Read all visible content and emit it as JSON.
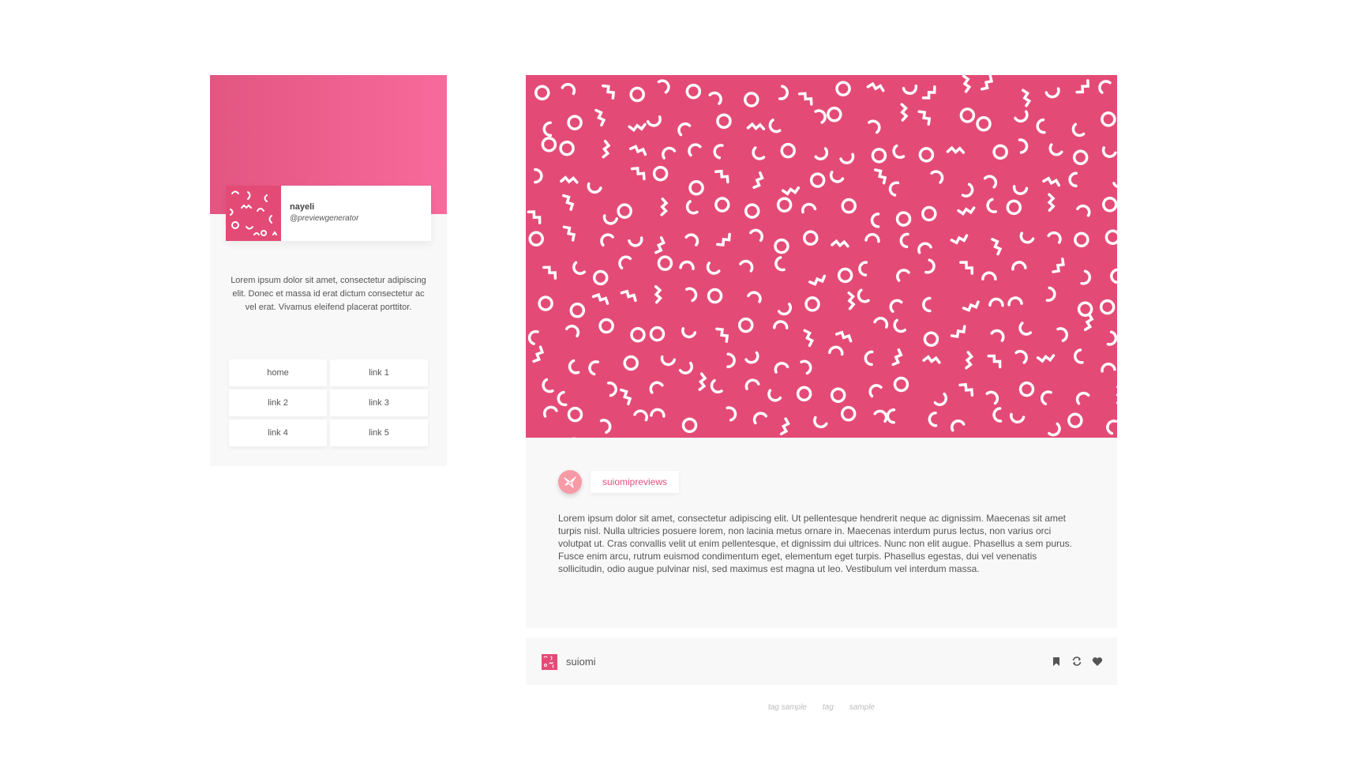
{
  "colors": {
    "accent": "#e34b76",
    "header_gradient_start": "#e25682",
    "header_gradient_end": "#f76a9b",
    "op_avatar": "#f79aa6",
    "panel": "#f8f8f8"
  },
  "sidebar": {
    "profile": {
      "name": "nayeli",
      "handle": "@previewgenerator",
      "avatar_icon": "pattern-avatar"
    },
    "bio": "Lorem ipsum dolor sit amet, consectetur adipiscing elit. Donec et massa id erat dictum consectetur ac vel erat. Vivamus eleifend placerat porttitor.",
    "nav": [
      {
        "label": "home"
      },
      {
        "label": "link 1"
      },
      {
        "label": "link 2"
      },
      {
        "label": "link 3"
      },
      {
        "label": "link 4"
      },
      {
        "label": "link 5"
      }
    ]
  },
  "post": {
    "image_icon": "memphis-squiggle-pattern",
    "op": {
      "name": "suiomipreviews",
      "avatar_icon": "hummingbird-icon"
    },
    "text": "Lorem ipsum dolor sit amet, consectetur adipiscing elit. Ut pellentesque hendrerit neque ac dignissim. Maecenas sit amet turpis nisl. Nulla ultricies posuere lorem, non lacinia metus ornare in. Maecenas interdum purus lectus, non varius orci volutpat ut. Cras convallis velit ut enim pellentesque, et dignissim dui ultrices. Nunc non elit augue. Phasellus a sem purus. Fusce enim arcu, rutrum euismod condimentum eget, elementum eget turpis. Phasellus egestas, dui vel venenatis sollicitudin, odio augue pulvinar nisl, sed maximus est magna ut leo. Vestibulum vel interdum massa.",
    "footer": {
      "username": "suiomi",
      "actions": [
        {
          "icon": "bookmark-icon"
        },
        {
          "icon": "reblog-icon"
        },
        {
          "icon": "heart-icon"
        }
      ]
    },
    "tags": [
      "tag sample",
      "tag",
      "sample"
    ]
  }
}
